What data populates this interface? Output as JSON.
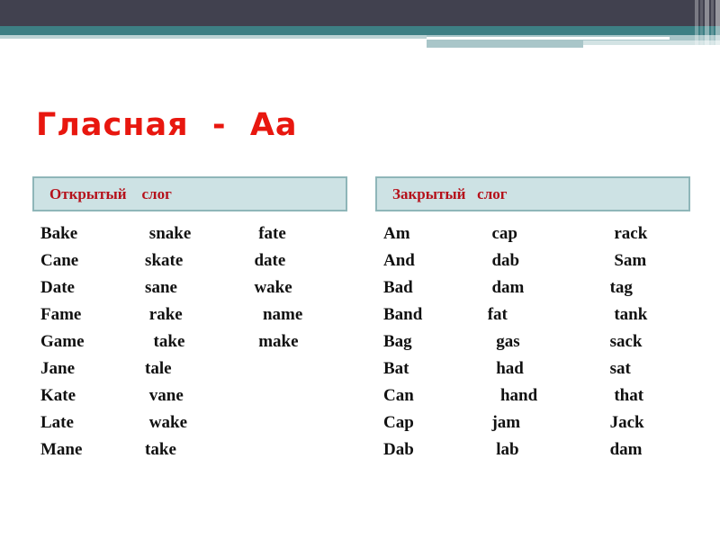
{
  "banner": {
    "colors": {
      "dark": "#41414f",
      "teal": "#3d7f84",
      "pale": "#bcd3d5",
      "pale_mid": "#a9c6c9",
      "pale_light": "#d3e3e4"
    }
  },
  "title": {
    "text": "Гласная  -  Аа",
    "color": "#e8170f"
  },
  "columns": [
    {
      "key": "open_syllable",
      "header": "Открытый    слог",
      "header_color": "#b5111b",
      "header_bg": "#cde2e4",
      "header_border": "#8fb6b9",
      "rows": [
        [
          "Bake",
          "   snake",
          "   fate"
        ],
        [
          "Cane",
          "  skate",
          "  date"
        ],
        [
          "Date",
          "  sane",
          "  wake"
        ],
        [
          "Fame",
          "   rake",
          "    name"
        ],
        [
          "Game",
          "    take",
          "   make"
        ],
        [
          "Jane",
          "  tale",
          ""
        ],
        [
          "Kate",
          "   vane",
          ""
        ],
        [
          "Late",
          "   wake",
          ""
        ],
        [
          "Mane",
          "  take",
          ""
        ]
      ]
    },
    {
      "key": "closed_syllable",
      "header": "Закрытый   слог",
      "header_color": "#b5111b",
      "header_bg": "#cde2e4",
      "header_border": "#8fb6b9",
      "rows": [
        [
          "Am",
          "   cap",
          "      rack"
        ],
        [
          "And",
          "   dab",
          "      Sam"
        ],
        [
          "Bad",
          "   dam",
          "     tag"
        ],
        [
          "Band",
          "  fat",
          "      tank"
        ],
        [
          "Bag",
          "    gas",
          "     sack"
        ],
        [
          "Bat",
          "    had",
          "     sat"
        ],
        [
          "Can",
          "     hand",
          "      that"
        ],
        [
          "Cap",
          "   jam",
          "     Jack"
        ],
        [
          "Dab",
          "    lab",
          "     dam"
        ]
      ]
    }
  ]
}
